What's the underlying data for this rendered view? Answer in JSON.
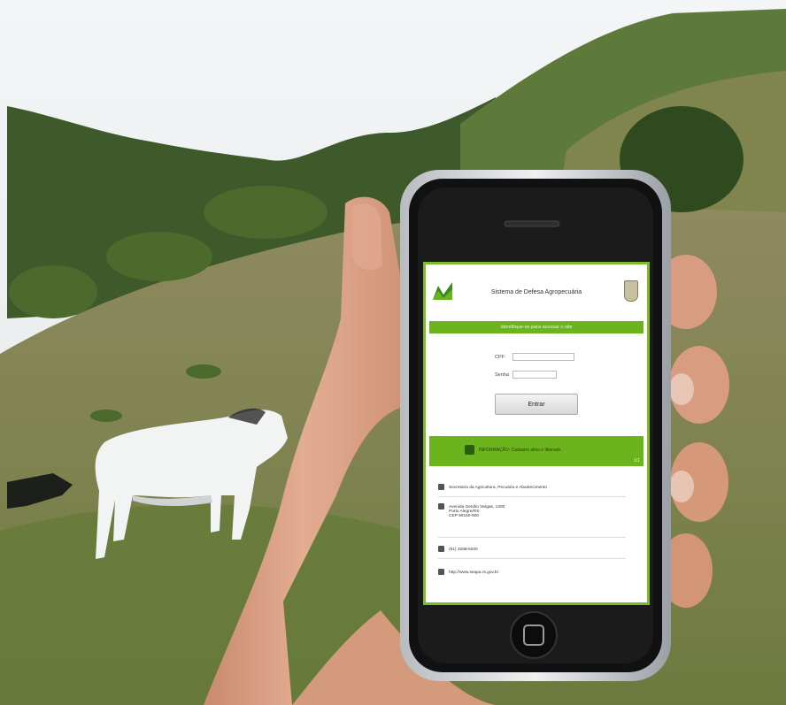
{
  "app": {
    "title": "Sistema de Defesa Agropecuária",
    "banner": "Identifique-se para acessar o site",
    "login": {
      "cpf_label": "CPF",
      "senha_label": "Senha",
      "submit_label": "Entrar"
    },
    "notice": {
      "text": "INFORMAÇÃO: Cadastro ativo e liberado",
      "count": "1/1"
    },
    "contact": {
      "org": "Secretaria da Agricultura, Pecuária e Abastecimento",
      "address": [
        "Avenida Getúlio Vargas, 1300",
        "Porto Alegre/RS",
        "CEP 90150-900"
      ],
      "phone": "(51) 3288-6200",
      "url": "http://www.seapa.rs.gov.br"
    }
  },
  "colors": {
    "accent": "#6cb41e",
    "screen_border": "#7dbb2a"
  }
}
